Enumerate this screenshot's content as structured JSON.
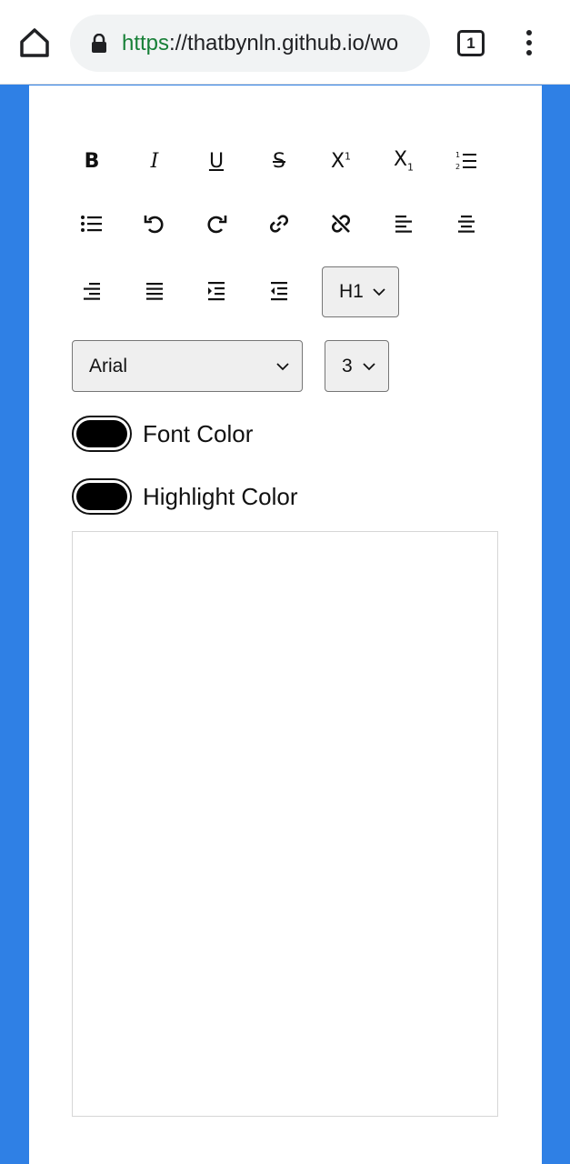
{
  "browser": {
    "url_scheme": "https",
    "url_rest": "://thatbynln.github.io/wo",
    "tab_count": "1"
  },
  "toolbar": {
    "row1": [
      {
        "name": "bold-button",
        "icon": "bold-icon",
        "label": "B"
      },
      {
        "name": "italic-button",
        "icon": "italic-icon",
        "label": "I"
      },
      {
        "name": "underline-button",
        "icon": "underline-icon",
        "label": "U"
      },
      {
        "name": "strikethrough-button",
        "icon": "strikethrough-icon",
        "label": "S"
      },
      {
        "name": "superscript-button",
        "icon": "superscript-icon",
        "label": "X"
      },
      {
        "name": "subscript-button",
        "icon": "subscript-icon",
        "label": "X"
      },
      {
        "name": "ordered-list-button",
        "icon": "ordered-list-icon",
        "label": ""
      }
    ],
    "row2": [
      {
        "name": "unordered-list-button",
        "icon": "unordered-list-icon"
      },
      {
        "name": "undo-button",
        "icon": "undo-icon"
      },
      {
        "name": "redo-button",
        "icon": "redo-icon"
      },
      {
        "name": "link-button",
        "icon": "link-icon"
      },
      {
        "name": "unlink-button",
        "icon": "unlink-icon"
      },
      {
        "name": "align-left-button",
        "icon": "align-left-icon"
      },
      {
        "name": "align-center-button",
        "icon": "align-center-icon"
      }
    ],
    "row3": [
      {
        "name": "align-right-button",
        "icon": "align-right-icon"
      },
      {
        "name": "align-justify-button",
        "icon": "align-justify-icon"
      },
      {
        "name": "indent-button",
        "icon": "indent-icon"
      },
      {
        "name": "outdent-button",
        "icon": "outdent-icon"
      }
    ],
    "heading_select": "H1",
    "font_select": "Arial",
    "size_select": "3"
  },
  "colors": {
    "font_color_label": "Font Color",
    "highlight_color_label": "Highlight Color",
    "font_color_value": "#000000",
    "highlight_color_value": "#000000"
  }
}
